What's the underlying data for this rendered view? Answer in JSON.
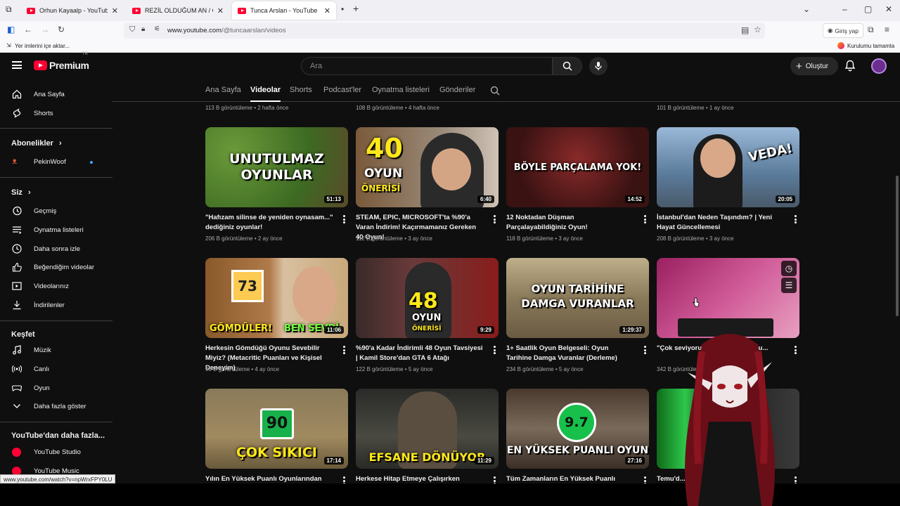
{
  "browser": {
    "tabs": [
      {
        "title": "Orhun Kayaalp - YouTube"
      },
      {
        "title": "REZİL OLDUĞUM AN / CNN MA"
      },
      {
        "title": "Tunca Arslan - YouTube"
      }
    ],
    "url_host": "www.youtube.com",
    "url_path": "/@tuncaarslan/videos",
    "sign_in": "Giriş yap",
    "bookmarks_import": "Yer imlerini içe aktar...",
    "setup_complete": "Kurulumu tamamla",
    "status_url": "www.youtube.com/watch?v=npWrxFPY0LU"
  },
  "header": {
    "logo_text": "Premium",
    "logo_sup": "TR",
    "search_placeholder": "Ara",
    "create_label": "Oluştur"
  },
  "sidebar": {
    "top": [
      {
        "label": "Ana Sayfa",
        "icon": "home-icon"
      },
      {
        "label": "Shorts",
        "icon": "shorts-icon"
      }
    ],
    "subscriptions_title": "Abonelikler",
    "subscriptions": [
      {
        "label": "PekinWoof"
      }
    ],
    "you_title": "Siz",
    "you": [
      {
        "label": "Geçmiş",
        "icon": "history-icon"
      },
      {
        "label": "Oynatma listeleri",
        "icon": "playlist-icon"
      },
      {
        "label": "Daha sonra izle",
        "icon": "clock-icon"
      },
      {
        "label": "Beğendiğim videolar",
        "icon": "like-icon"
      },
      {
        "label": "Videolarınız",
        "icon": "video-icon"
      },
      {
        "label": "İndirilenler",
        "icon": "download-icon"
      }
    ],
    "explore_title": "Keşfet",
    "explore": [
      {
        "label": "Müzik",
        "icon": "music-icon"
      },
      {
        "label": "Canlı",
        "icon": "live-icon"
      },
      {
        "label": "Oyun",
        "icon": "gaming-icon"
      },
      {
        "label": "Daha fazla göster",
        "icon": "chevron-down-icon"
      }
    ],
    "more_title": "YouTube'dan daha fazla...",
    "more": [
      {
        "label": "YouTube Studio"
      },
      {
        "label": "YouTube Music"
      }
    ]
  },
  "channel_tabs": [
    "Ana Sayfa",
    "Videolar",
    "Shorts",
    "Podcast'ler",
    "Oynatma listeleri",
    "Gönderiler"
  ],
  "top_meta": [
    "113 B görüntüleme • 2 hafta önce",
    "108 B görüntüleme • 4 hafta önce",
    "101 B görüntüleme • 1 ay önce"
  ],
  "videos": [
    {
      "title": "\"Hafızam silinse de yeniden oynasam...\" dediğiniz oyunlar!",
      "meta": "206 B görüntüleme • 2 ay önce",
      "duration": "51:13",
      "overlay": "UNUTULMAZ\nOYUNLAR",
      "bg": "#4f7a2e"
    },
    {
      "title": "STEAM, EPIC, MICROSOFT'ta %90'a Varan İndirim! Kaçırmamanız Gereken 40 Oyun!",
      "meta": "112 B görüntüleme • 3 ay önce",
      "duration": "6:40",
      "overlay": "40",
      "overlay2": "OYUN",
      "overlay3": "ÖNERİSİ",
      "bg": "#6b5a48"
    },
    {
      "title": "12 Noktadan Düşman Parçalayabildiğiniz Oyun!",
      "meta": "118 B görüntüleme • 3 ay önce",
      "duration": "14:52",
      "overlay": "BÖYLE PARÇALAMA YOK!",
      "bg": "#5a1c1c"
    },
    {
      "title": "İstanbul'dan Neden Taşındım? | Yeni Hayat Güncellemesi",
      "meta": "208 B görüntüleme • 3 ay önce",
      "duration": "20:05",
      "overlay": "VEDA!",
      "bg": "#6f8fb3"
    },
    {
      "title": "Herkesin Gömdüğü Oyunu Sevebilir Miyiz? (Metacritic Puanları ve Kişisel Deneyim)",
      "meta": "98 B görüntüleme • 4 ay önce",
      "duration": "11:06",
      "overlay": "GÖMDÜLER!",
      "overlay2": "BEN SEVDİ",
      "overlay3": "73",
      "bg": "#7a4a2a"
    },
    {
      "title": "%90'a Kadar İndirimli 48 Oyun Tavsiyesi | Kamil Store'dan GTA 6 Atağı",
      "meta": "122 B görüntüleme • 5 ay önce",
      "duration": "9:29",
      "overlay": "48",
      "overlay2": "OYUN",
      "overlay3": "ÖNERİSİ",
      "bg": "#5c2a2a"
    },
    {
      "title": "1+ Saatlik Oyun Belgeseli: Oyun Tarihine Damga Vuranlar (Derleme)",
      "meta": "234 B görüntüleme • 5 ay önce",
      "duration": "1:29:37",
      "overlay": "OYUN TARİHİNE\nDAMGA VURANLAR",
      "bg": "#8a7a5e"
    },
    {
      "title": "\"Çok seviyoru... ...\" dediğiniz oyu...",
      "meta": "342 B görüntüleme",
      "duration": "",
      "overlay": "",
      "bg": "#c24b8a"
    },
    {
      "title": "Yılın En Yüksek Puanlı Oyunlarından Biri",
      "meta": "",
      "duration": "17:14",
      "overlay": "ÇOK SIKICI",
      "overlay3": "90",
      "bg": "#8a7a50"
    },
    {
      "title": "Herkese Hitap Etmeye Çalışırken Kendini",
      "meta": "",
      "duration": "11:29",
      "overlay": "EFSANE DÖNÜYOR",
      "bg": "#3e3a33"
    },
    {
      "title": "Tüm Zamanların En Yüksek Puanlı Oyunu!",
      "meta": "",
      "duration": "27:16",
      "overlay": "EN YÜKSEK PUANLI OYUN",
      "overlay3": "9.7",
      "bg": "#5a4a3a"
    },
    {
      "title": "Temu'd...",
      "meta": "",
      "duration": "",
      "overlay": "",
      "bg": "#1f8a2a"
    }
  ]
}
